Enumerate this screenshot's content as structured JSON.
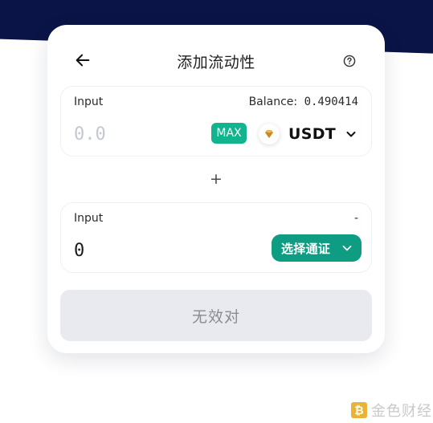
{
  "header": {
    "title": "添加流动性"
  },
  "input1": {
    "label": "Input",
    "balance_label": "Balance:",
    "balance_value": "0.490414",
    "placeholder": "0.0",
    "max_label": "MAX",
    "token": "USDT"
  },
  "plus_symbol": "+",
  "input2": {
    "label": "Input",
    "balance": "-",
    "placeholder": "0",
    "select_label": "选择通证"
  },
  "submit_label": "无效对",
  "watermark": {
    "logo_text": "金色财经"
  },
  "colors": {
    "accent": "#12b38f",
    "select_button": "#0e9d82",
    "top_band": "#0b1447",
    "disabled_button": "#e9eaef"
  }
}
